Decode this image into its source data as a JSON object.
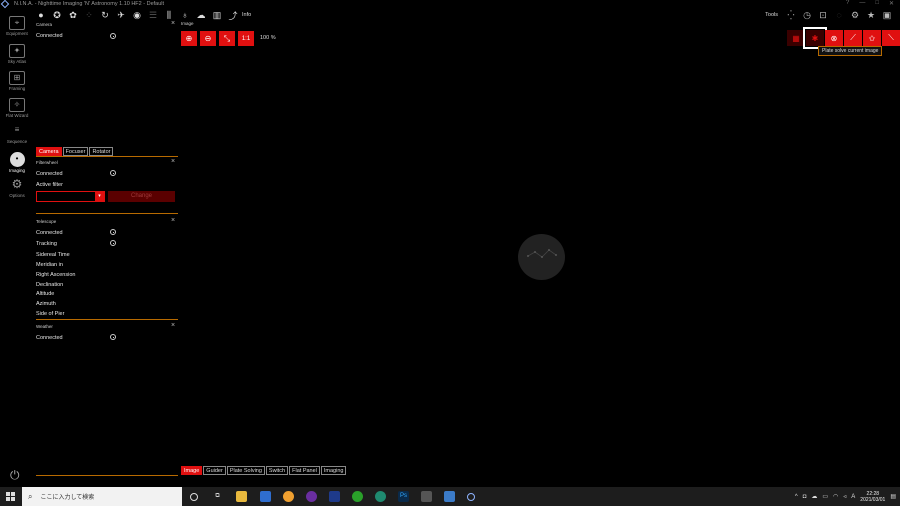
{
  "window": {
    "title": "N.I.N.A. - Nighttime Imaging 'N' Astronomy 1.10 HF2 - Default",
    "controls": [
      "?",
      "—",
      "□",
      "✕"
    ]
  },
  "top_toolbar": {
    "info_label": "Info",
    "tools_label": "Tools"
  },
  "sidebar": {
    "items": [
      {
        "label": "Equipment",
        "icon": "telescope-icon"
      },
      {
        "label": "Sky Atlas",
        "icon": "sky-atlas-icon"
      },
      {
        "label": "Framing",
        "icon": "framing-icon"
      },
      {
        "label": "Flat Wizard",
        "icon": "flat-wizard-icon"
      },
      {
        "label": "Sequence",
        "icon": "sequence-icon"
      },
      {
        "label": "Imaging",
        "icon": "imaging-icon",
        "active": true
      },
      {
        "label": "Options",
        "icon": "gear-icon"
      }
    ]
  },
  "camera_panel": {
    "title": "Camera",
    "connected_label": "Connected"
  },
  "device_tabs": [
    "Camera",
    "Focuser",
    "Rotator"
  ],
  "filterwheel_panel": {
    "title": "Filterwheel",
    "connected_label": "Connected",
    "active_filter_label": "Active filter",
    "filter_value": "",
    "change_label": "Change"
  },
  "telescope_panel": {
    "title": "Telescope",
    "rows": [
      "Connected",
      "Tracking",
      "Sidereal Time",
      "Meridian in",
      "Right Ascension",
      "Declination",
      "Altitude",
      "Azimuth",
      "Side of Pier"
    ]
  },
  "weather_panel": {
    "title": "Weather",
    "connected_label": "Connected"
  },
  "image_panel": {
    "title": "Image",
    "one_to_one_label": "1:1",
    "zoom_value": "100 %",
    "tooltip": "Plate solve current image"
  },
  "bottom_tabs": [
    "Image",
    "Guider",
    "Plate Solving",
    "Switch",
    "Flat Panel",
    "Imaging"
  ],
  "taskbar": {
    "search_placeholder": "ここに入力して検索",
    "time": "22:28",
    "date": "2021/03/01",
    "ime_label": "A"
  },
  "colors": {
    "accent": "#e01010",
    "divider": "#b76a00",
    "background": "#000000"
  }
}
